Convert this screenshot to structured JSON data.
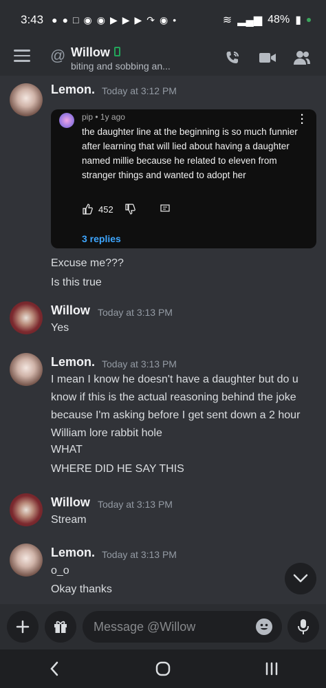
{
  "status_bar": {
    "time": "3:43",
    "battery": "48%"
  },
  "header": {
    "channel_prefix": "@",
    "name": "Willow",
    "status_text": "biting and sobbing an..."
  },
  "messages": [
    {
      "author": "Lemon.",
      "time": "Today at 3:12 PM",
      "embed": {
        "commenter": "pip",
        "age": "1y ago",
        "body": "the daughter line at the beginning is so much funnier after learning that will lied about having a daughter named millie because he related to eleven from stranger things and wanted to adopt her",
        "likes": "452",
        "replies": "3 replies"
      },
      "lines": [
        "Excuse me???",
        "Is this true"
      ]
    },
    {
      "author": "Willow",
      "time": "Today at 3:13 PM",
      "lines": [
        "Yes"
      ]
    },
    {
      "author": "Lemon.",
      "time": "Today at 3:13 PM",
      "lines": [
        "I mean I know he doesn't have a daughter but do u know if this is the actual reasoning behind the joke because I'm asking before I get sent down a 2 hour William lore rabbit hole",
        "WHAT",
        "WHERE DID HE SAY THIS"
      ]
    },
    {
      "author": "Willow",
      "time": "Today at 3:13 PM",
      "lines": [
        "Stream"
      ]
    },
    {
      "author": "Lemon.",
      "time": "Today at 3:13 PM",
      "lines": [
        "o_o",
        "Okay thanks"
      ]
    }
  ],
  "composer": {
    "placeholder": "Message @Willow"
  },
  "colors": {
    "background": "#313338",
    "header": "#2b2d31",
    "link": "#3ea6ff",
    "online": "#23a55a"
  }
}
